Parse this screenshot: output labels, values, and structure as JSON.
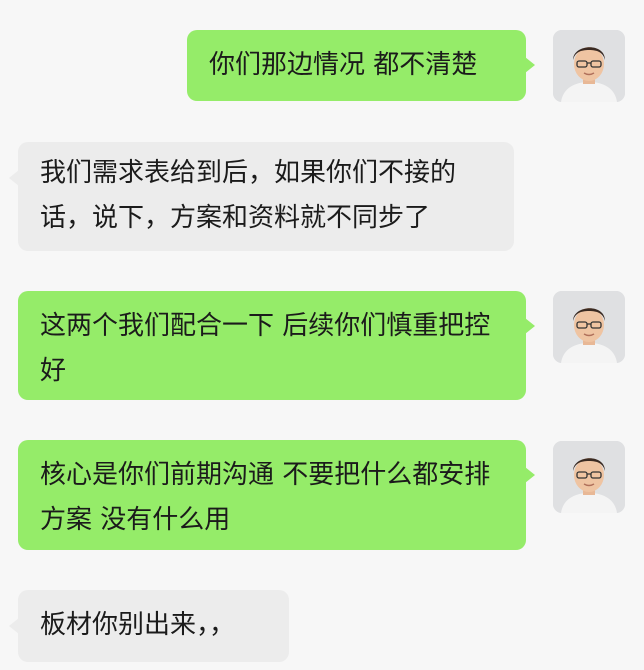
{
  "messages": [
    {
      "side": "sent",
      "text": "你们那边情况 都不清楚"
    },
    {
      "side": "received",
      "text": "我们需求表给到后，如果你们不接的话，说下，方案和资料就不同步了"
    },
    {
      "side": "sent",
      "text": "这两个我们配合一下 后续你们慎重把控好"
    },
    {
      "side": "sent",
      "text": "核心是你们前期沟通 不要把什么都安排方案 没有什么用"
    },
    {
      "side": "received",
      "text": "板材你别出来，，"
    }
  ],
  "colors": {
    "background": "#f7f7f7",
    "sent_bubble": "#95ec69",
    "received_bubble": "#ececec",
    "text": "#1b1b1b"
  },
  "avatar_icon": "user-avatar-icon"
}
